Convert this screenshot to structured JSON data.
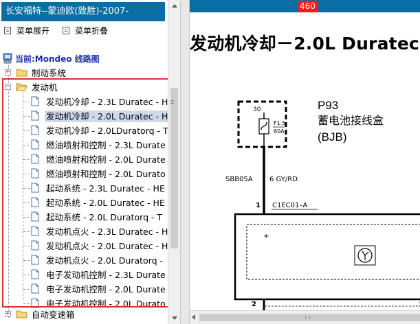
{
  "window": {
    "title": "长安福特--蒙迪欧(致胜)-2007-"
  },
  "toolbar": {
    "expand_label": "菜单展开",
    "collapse_label": "菜单折叠"
  },
  "current": {
    "label": "当前:Mondeo 线路图"
  },
  "tree": {
    "groups": [
      {
        "label": "制动系统",
        "expanded": false
      },
      {
        "label": "发动机",
        "expanded": true
      },
      {
        "label": "自动变速箱",
        "expanded": false
      }
    ],
    "engine_items": [
      {
        "label": "发动机冷却 - 2.3L Duratec - H",
        "selected": false
      },
      {
        "label": "发动机冷却 - 2.0L Duratec - H",
        "selected": true
      },
      {
        "label": "发动机冷却 - 2.0LDuratorq - T",
        "selected": false
      },
      {
        "label": "燃油喷射和控制 - 2.3L Durate",
        "selected": false
      },
      {
        "label": "燃油喷射和控制 - 2.0L Durate",
        "selected": false
      },
      {
        "label": "燃油喷射和控制 - 2.0L Durato",
        "selected": false
      },
      {
        "label": "起动系统 - 2.3L Duratec - HE",
        "selected": false
      },
      {
        "label": "起动系统 - 2.0L Duratec - HE",
        "selected": false
      },
      {
        "label": "起动系统 - 2.0L Duratorq - T",
        "selected": false
      },
      {
        "label": "发动机点火 - 2.3L Duratec - H",
        "selected": false
      },
      {
        "label": "发动机点火 - 2.0L Duratec - H",
        "selected": false
      },
      {
        "label": "发动机点火 - 2.0L Duratorq -",
        "selected": false
      },
      {
        "label": "电子发动机控制 - 2.3L Durate",
        "selected": false
      },
      {
        "label": "电子发动机控制 - 2.0L Durate",
        "selected": false
      },
      {
        "label": "电子发动机控制 - 2.0L Durato",
        "selected": false
      }
    ]
  },
  "page": {
    "number": "460",
    "title": "发动机冷却－2.0L Duratec"
  },
  "diagram": {
    "bjb_code": "P93",
    "bjb_name": "蓄电池接线盒",
    "bjb_abbr": "(BJB)",
    "fuse_pin": "30",
    "fuse_label": "F1.5",
    "fuse_rating": "60A",
    "wire_circuit": "SBB05A",
    "wire_spec": "6 GY/RD",
    "connector_pin_top": "1",
    "connector_id": "C1EC01–A",
    "connector_pin_bottom": "2",
    "terminal_mark": "+"
  },
  "colors": {
    "title_bar": "#0a6ea4",
    "page_number_bg": "#ff1a1a",
    "current_label": "#1b2ea8",
    "highlight": "#e03030",
    "selection": "#d0d9ea"
  }
}
